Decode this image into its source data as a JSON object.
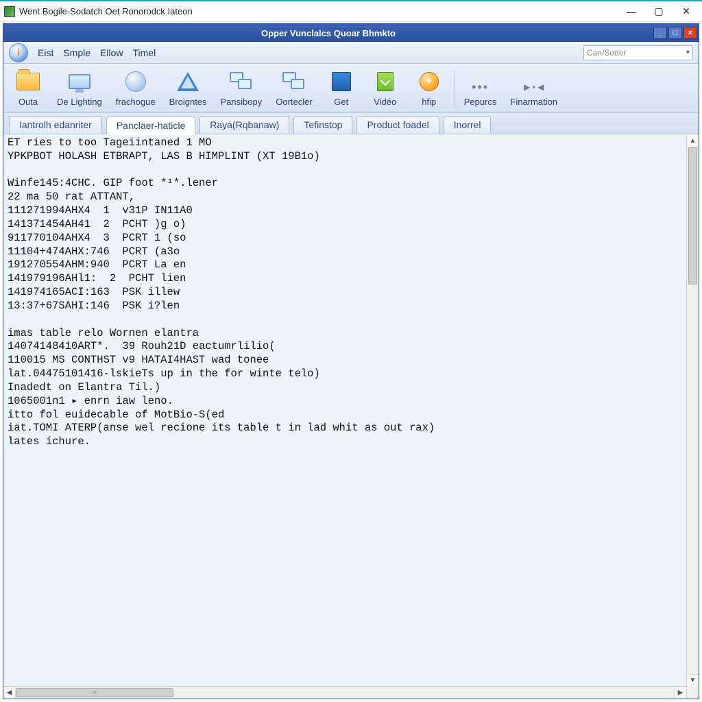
{
  "outer": {
    "title": "Went Bogile-Sodatch Oet Ronorodck Iateon"
  },
  "inner": {
    "title": "Opper Vunclalcs Quoar Bhmkto"
  },
  "menu": {
    "items": [
      "Eist",
      "Smple",
      "Ellow",
      "Timel"
    ],
    "search_placeholder": "Can/Soder"
  },
  "ribbon": {
    "buttons": [
      {
        "label": "Outa",
        "icon": "folder"
      },
      {
        "label": "De Lighting",
        "icon": "monitor"
      },
      {
        "label": "frachogue",
        "icon": "globe"
      },
      {
        "label": "Broigntes",
        "icon": "triangle"
      },
      {
        "label": "Pansibopy",
        "icon": "screens"
      },
      {
        "label": "Oortecler",
        "icon": "screens"
      },
      {
        "label": "Get",
        "icon": "blue-square"
      },
      {
        "label": "Vidéo",
        "icon": "green"
      },
      {
        "label": "hfip",
        "icon": "orange-plus"
      }
    ],
    "overflow": [
      {
        "label": "Pepurcs",
        "icon": "dots"
      },
      {
        "label": "Finarmation",
        "icon": "play"
      }
    ]
  },
  "tabs": {
    "items": [
      "Iantrolh edanriter",
      "Panclaer-haticle",
      "Raya(Rqbanaw)",
      "Tefinstop",
      "Product foadel",
      "Inorrel"
    ],
    "active_index": 1
  },
  "log": {
    "lines": [
      "ET ries to too Tageiintaned 1 MO",
      "YPKPBOT HOLASH ETBRAPT, LAS B HIMPLINT (XT 19B1o)",
      "",
      "Winfe145:4CHC. GIP foot *¹*.lener",
      "22 ma 50 rat ATTANT,",
      "111271994AHX4  1  v31P IN11A0",
      "141371454AH41  2  PCHT )g o)",
      "911770104AHX4  3  PCRT 1 (so",
      "11104+474AHX:746  PCRT (a3o",
      "191270554AHM:940  PCRT La en",
      "141979196AHl1:  2  PCHT lien",
      "141974165ACI:163  PSK illew",
      "13:37+67SAHI:146  PSK i?len",
      "",
      "imas table relo Wornen elantra",
      "14074148410ART*.  39 Rouh21D eactumrlilio(",
      "110015 MS CONTHST v9 HATAI4HAST wad tonee",
      "lat.04475101416-lskieTs up in the for winte telo)",
      "Inadedt on Elantra Til.)",
      "1065001n1 ▸ enrn iaw leno.",
      "itto fol euidecable of MotBio-S(ed",
      "iat.TOMI ATERP(anse wel recione its table t in lad whit as out rax)",
      "lates íchure."
    ]
  }
}
